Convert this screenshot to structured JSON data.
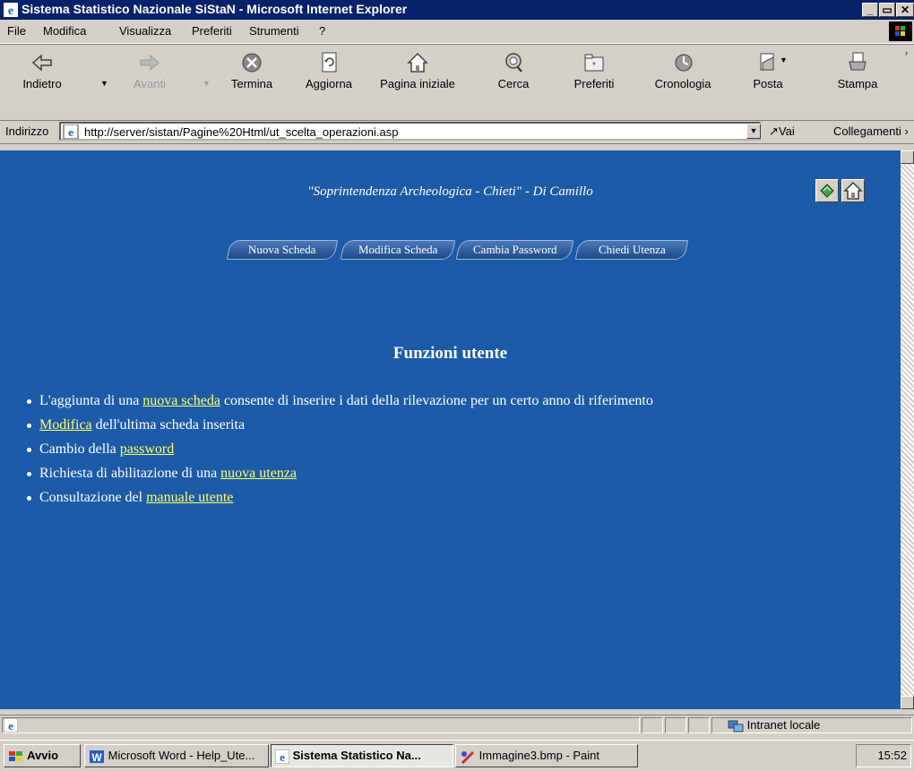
{
  "window": {
    "title": "Sistema Statistico Nazionale SiStaN - Microsoft Internet Explorer"
  },
  "menu": [
    "File",
    "Modifica",
    "Visualizza",
    "Preferiti",
    "Strumenti",
    "?"
  ],
  "toolbar": {
    "back": "Indietro",
    "forward": "Avanti",
    "stop": "Termina",
    "refresh": "Aggiorna",
    "home": "Pagina iniziale",
    "search": "Cerca",
    "favorites": "Preferiti",
    "history": "Cronologia",
    "mail": "Posta",
    "print": "Stampa"
  },
  "address": {
    "label": "Indirizzo",
    "url": "http://server/sistan/Pagine%20Html/ut_scelta_operazioni.asp",
    "go": "Vai",
    "links": "Collegamenti"
  },
  "page": {
    "header": "\"Soprintendenza Archeologica - Chieti\" - Di Camillo",
    "nav": [
      "Nuova Scheda",
      "Modifica Scheda",
      "Cambia Password",
      "Chiedi Utenza"
    ],
    "section_title": "Funzioni utente",
    "items": [
      {
        "before": "L'aggiunta di una ",
        "link": "nuova scheda",
        "after": " consente di inserire i dati della rilevazione per un certo anno di riferimento"
      },
      {
        "before": "",
        "link": "Modifica",
        "after": " dell'ultima scheda inserita"
      },
      {
        "before": "Cambio della ",
        "link": "password",
        "after": ""
      },
      {
        "before": "Richiesta di abilitazione di una ",
        "link": "nuova utenza",
        "after": ""
      },
      {
        "before": "Consultazione del ",
        "link": "manuale utente",
        "after": ""
      }
    ]
  },
  "status": {
    "zone": "Intranet locale"
  },
  "taskbar": {
    "start": "Avvio",
    "tasks": [
      "Microsoft Word - Help_Ute...",
      "Sistema Statistico Na...",
      "Immagine3.bmp - Paint"
    ],
    "clock": "15:52"
  },
  "colors": {
    "page_bg": "#1c5ba8",
    "link": "#ffff66",
    "titlebar": "#08216b"
  }
}
